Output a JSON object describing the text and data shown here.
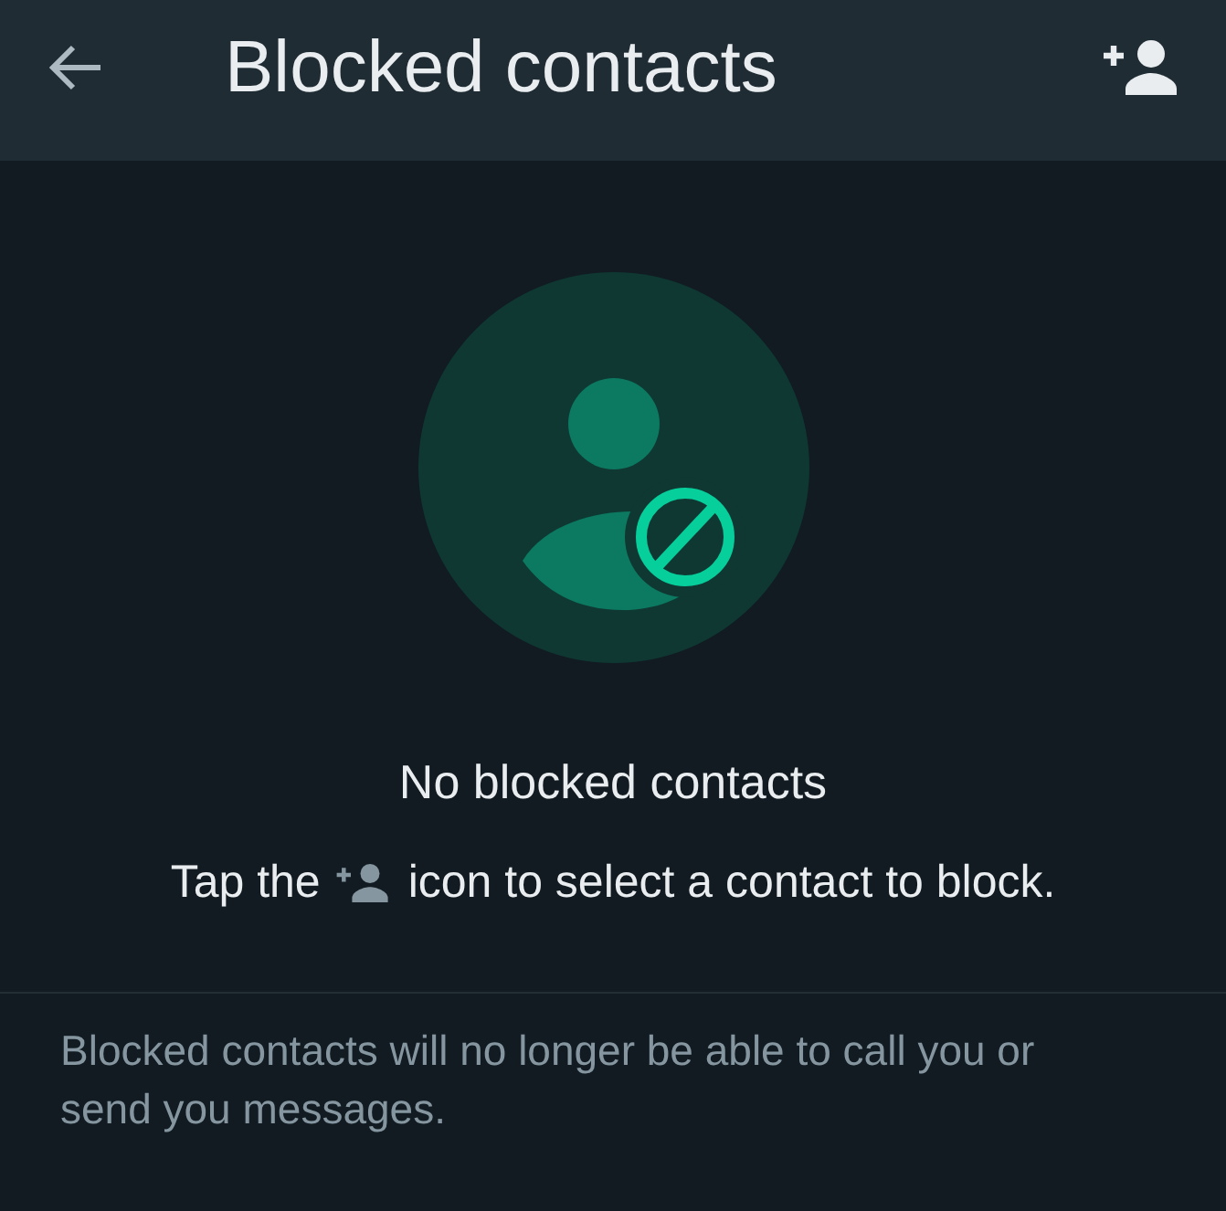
{
  "header": {
    "title": "Blocked contacts"
  },
  "empty_state": {
    "title": "No blocked contacts",
    "hint": {
      "before": "Tap the",
      "after": "icon to select a contact to block."
    }
  },
  "footer_note": "Blocked contacts will no longer be able to call you or send you messages."
}
